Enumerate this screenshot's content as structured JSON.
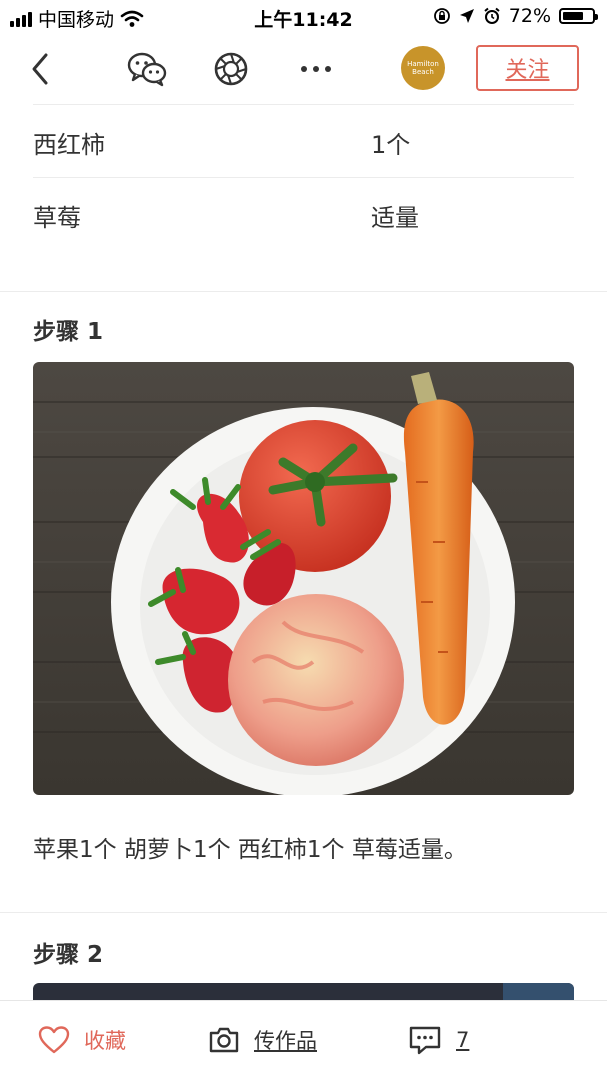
{
  "status_bar": {
    "carrier": "中国移动",
    "time": "上午11:42",
    "battery": "72%",
    "battery_level": 0.72
  },
  "nav": {
    "back_icon": "chevron-left-icon",
    "wechat_icon": "wechat-icon",
    "moments_icon": "moments-icon",
    "more_icon": "more-icon",
    "avatar_text_1": "Hamilton",
    "avatar_text_2": "Beach",
    "follow_label": "关注"
  },
  "ingredients": [
    {
      "name": "西红柿",
      "qty": "1个"
    },
    {
      "name": "草莓",
      "qty": "适量"
    }
  ],
  "steps": [
    {
      "title": "步骤 1",
      "text": "苹果1个 胡萝卜1个 西红柿1个 草莓适量。"
    },
    {
      "title": "步骤 2"
    }
  ],
  "bottom_bar": {
    "favorite_label": "收藏",
    "upload_label": "传作品",
    "comment_count": "7"
  },
  "colors": {
    "accent": "#e0685a",
    "avatar_bg": "#c8942a"
  }
}
